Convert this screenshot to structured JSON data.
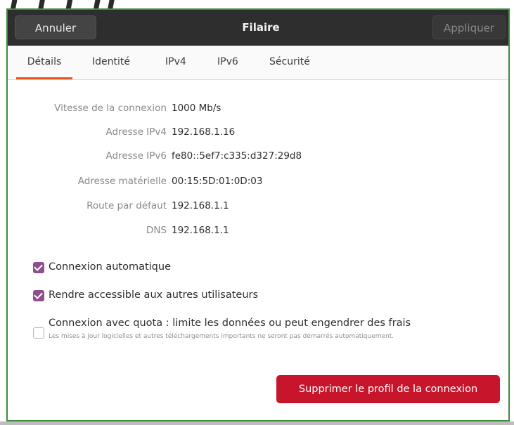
{
  "banner": {
    "text": "I I I II"
  },
  "titlebar": {
    "cancel_label": "Annuler",
    "title": "Filaire",
    "apply_label": "Appliquer"
  },
  "tabs": [
    {
      "label": "Détails",
      "active": true
    },
    {
      "label": "Identité",
      "active": false
    },
    {
      "label": "IPv4",
      "active": false
    },
    {
      "label": "IPv6",
      "active": false
    },
    {
      "label": "Sécurité",
      "active": false
    }
  ],
  "details": [
    {
      "label": "Vitesse de la connexion",
      "value": "1000 Mb/s"
    },
    {
      "label": "Adresse IPv4",
      "value": "192.168.1.16"
    },
    {
      "label": "Adresse IPv6",
      "value": "fe80::5ef7:c335:d327:29d8"
    },
    {
      "label": "Adresse matérielle",
      "value": "00:15:5D:01:0D:03"
    },
    {
      "label": "Route par défaut",
      "value": "192.168.1.1"
    },
    {
      "label": "DNS",
      "value": "192.168.1.1"
    }
  ],
  "options": [
    {
      "label": "Connexion automatique",
      "checked": true
    },
    {
      "label": "Rendre accessible aux autres utilisateurs",
      "checked": true
    },
    {
      "label": "Connexion avec quota : limite les données ou peut engendrer des frais",
      "sublabel": "Les mises à jour logicielles et autres téléchargements importants ne seront pas démarrés automatiquement.",
      "checked": false
    }
  ],
  "delete_button": {
    "label": "Supprimer le profil de la connexion"
  },
  "colors": {
    "accent_tab": "#e95420",
    "checkbox": "#8f4f8e",
    "destructive": "#c7162b",
    "titlebar": "#2e2e2e"
  }
}
